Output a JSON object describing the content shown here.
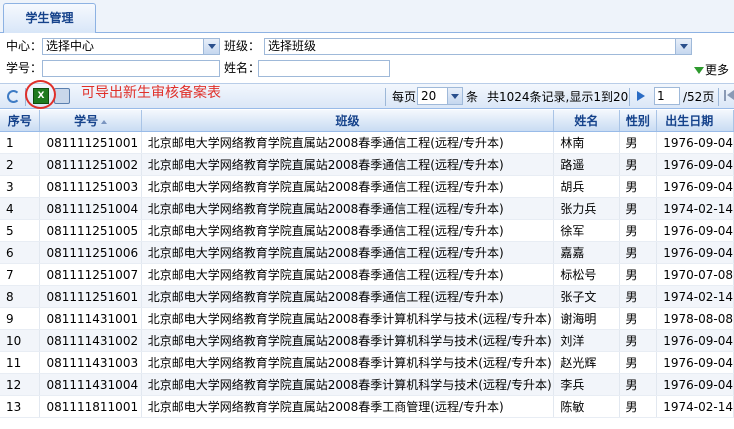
{
  "tab": {
    "label": "学生管理"
  },
  "form": {
    "center_label": "中心：",
    "center_value": "选择中心",
    "class_label": "班级：",
    "class_value": "选择班级",
    "student_no_label": "学号：",
    "name_label": "姓名：",
    "more_label": "更多"
  },
  "toolbar": {
    "excel_glyph": "X",
    "annotation": "可导出新生审核备案表",
    "per_page_label": "每页",
    "per_page_value": "20",
    "per_page_unit": "条",
    "summary": "共1024条记录,显示1到20",
    "current_page": "1",
    "total_pages": "/52页"
  },
  "table": {
    "headers": [
      "序号",
      "学号",
      "班级",
      "姓名",
      "性别",
      "出生日期"
    ],
    "rows": [
      [
        "1",
        "081111251001",
        "北京邮电大学网络教育学院直属站2008春季通信工程(远程/专升本)",
        "林南",
        "男",
        "1976-09-04"
      ],
      [
        "2",
        "081111251002",
        "北京邮电大学网络教育学院直属站2008春季通信工程(远程/专升本)",
        "路遥",
        "男",
        "1976-09-04"
      ],
      [
        "3",
        "081111251003",
        "北京邮电大学网络教育学院直属站2008春季通信工程(远程/专升本)",
        "胡兵",
        "男",
        "1976-09-04"
      ],
      [
        "4",
        "081111251004",
        "北京邮电大学网络教育学院直属站2008春季通信工程(远程/专升本)",
        "张力兵",
        "男",
        "1974-02-14"
      ],
      [
        "5",
        "081111251005",
        "北京邮电大学网络教育学院直属站2008春季通信工程(远程/专升本)",
        "徐军",
        "男",
        "1976-09-04"
      ],
      [
        "6",
        "081111251006",
        "北京邮电大学网络教育学院直属站2008春季通信工程(远程/专升本)",
        "嘉嘉",
        "男",
        "1976-09-04"
      ],
      [
        "7",
        "081111251007",
        "北京邮电大学网络教育学院直属站2008春季通信工程(远程/专升本)",
        "标松号",
        "男",
        "1970-07-08"
      ],
      [
        "8",
        "081111251601",
        "北京邮电大学网络教育学院直属站2008春季通信工程(远程/专升本)",
        "张子文",
        "男",
        "1974-02-14"
      ],
      [
        "9",
        "081111431001",
        "北京邮电大学网络教育学院直属站2008春季计算机科学与技术(远程/专升本)",
        "谢海明",
        "男",
        "1978-08-08"
      ],
      [
        "10",
        "081111431002",
        "北京邮电大学网络教育学院直属站2008春季计算机科学与技术(远程/专升本)",
        "刘洋",
        "男",
        "1976-09-04"
      ],
      [
        "11",
        "081111431003",
        "北京邮电大学网络教育学院直属站2008春季计算机科学与技术(远程/专升本)",
        "赵光辉",
        "男",
        "1976-09-04"
      ],
      [
        "12",
        "081111431004",
        "北京邮电大学网络教育学院直属站2008春季计算机科学与技术(远程/专升本)",
        "李兵",
        "男",
        "1976-09-04"
      ],
      [
        "13",
        "081111811001",
        "北京邮电大学网络教育学院直属站2008春季工商管理(远程/专升本)",
        "陈敏",
        "男",
        "1974-02-14"
      ]
    ]
  }
}
